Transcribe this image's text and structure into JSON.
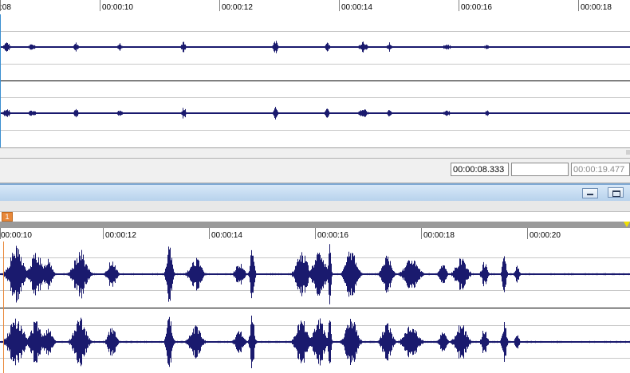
{
  "top_panel": {
    "ruler_labels": [
      ":08",
      "00:00:10",
      "00:00:12",
      "00:00:14",
      "00:00:16",
      "00:00:18"
    ]
  },
  "status": {
    "current_time": "00:00:08.333",
    "selection": "",
    "duration": "00:00:19.477"
  },
  "bottom_panel": {
    "marker_label": "1",
    "ruler_labels": [
      "00:00:10",
      "00:00:12",
      "00:00:14",
      "00:00:16",
      "00:00:18",
      "00:00:20"
    ]
  },
  "colors": {
    "waveform": "#1a1a6e",
    "cursor": "#3b8fd0",
    "marker": "#e8883a",
    "divider": "#b8d2ec"
  }
}
